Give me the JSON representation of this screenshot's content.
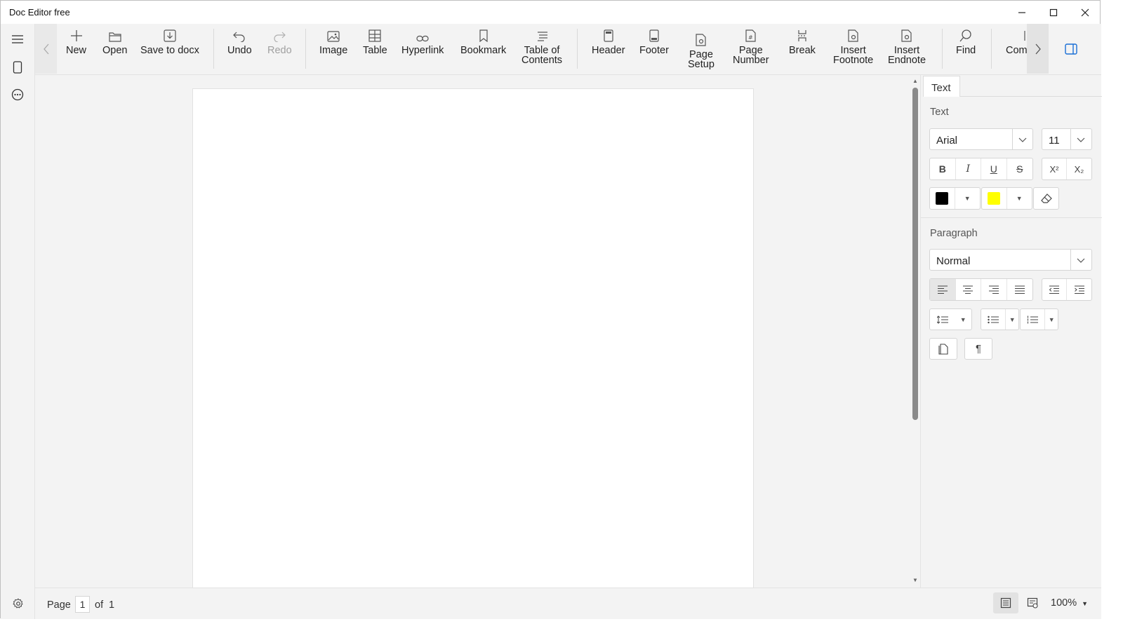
{
  "window": {
    "title": "Doc Editor free",
    "controls": {
      "minimize": "minimize",
      "maximize": "maximize",
      "close": "close"
    }
  },
  "rail": {
    "items": [
      {
        "icon": "hamburger-menu-icon"
      },
      {
        "icon": "page-icon"
      },
      {
        "icon": "more-circle-icon"
      }
    ],
    "settings_icon": "gear-icon"
  },
  "toolbar": {
    "new": "New",
    "open": "Open",
    "save": "Save to docx",
    "undo": "Undo",
    "redo": "Redo",
    "image": "Image",
    "table": "Table",
    "hyperlink": "Hyperlink",
    "bookmark": "Bookmark",
    "toc_line1": "Table of",
    "toc_line2": "Contents",
    "header": "Header",
    "footer": "Footer",
    "page_setup_line1": "Page",
    "page_setup_line2": "Setup",
    "page_number_line1": "Page",
    "page_number_line2": "Number",
    "break": "Break",
    "footnote_line1": "Insert",
    "footnote_line2": "Footnote",
    "endnote_line1": "Insert",
    "endnote_line2": "Endnote",
    "find": "Find",
    "comment_partial": "Com",
    "redo_disabled": true
  },
  "right_panel": {
    "tab": "Text",
    "text_section": "Text",
    "font_family": "Arial",
    "font_size": "11",
    "format_buttons": {
      "bold": "B",
      "italic": "I",
      "underline": "U",
      "strike": "S",
      "superscript": "X²",
      "subscript": "X₂"
    },
    "font_color": "#000000",
    "highlight_color": "#ffff00",
    "paragraph_section": "Paragraph",
    "paragraph_style": "Normal",
    "alignment_active": "left",
    "pilcrow": "¶"
  },
  "status": {
    "page_label": "Page",
    "page_current": "1",
    "page_of": "of",
    "page_total": "1",
    "zoom": "100%",
    "view_active": "print-layout"
  }
}
